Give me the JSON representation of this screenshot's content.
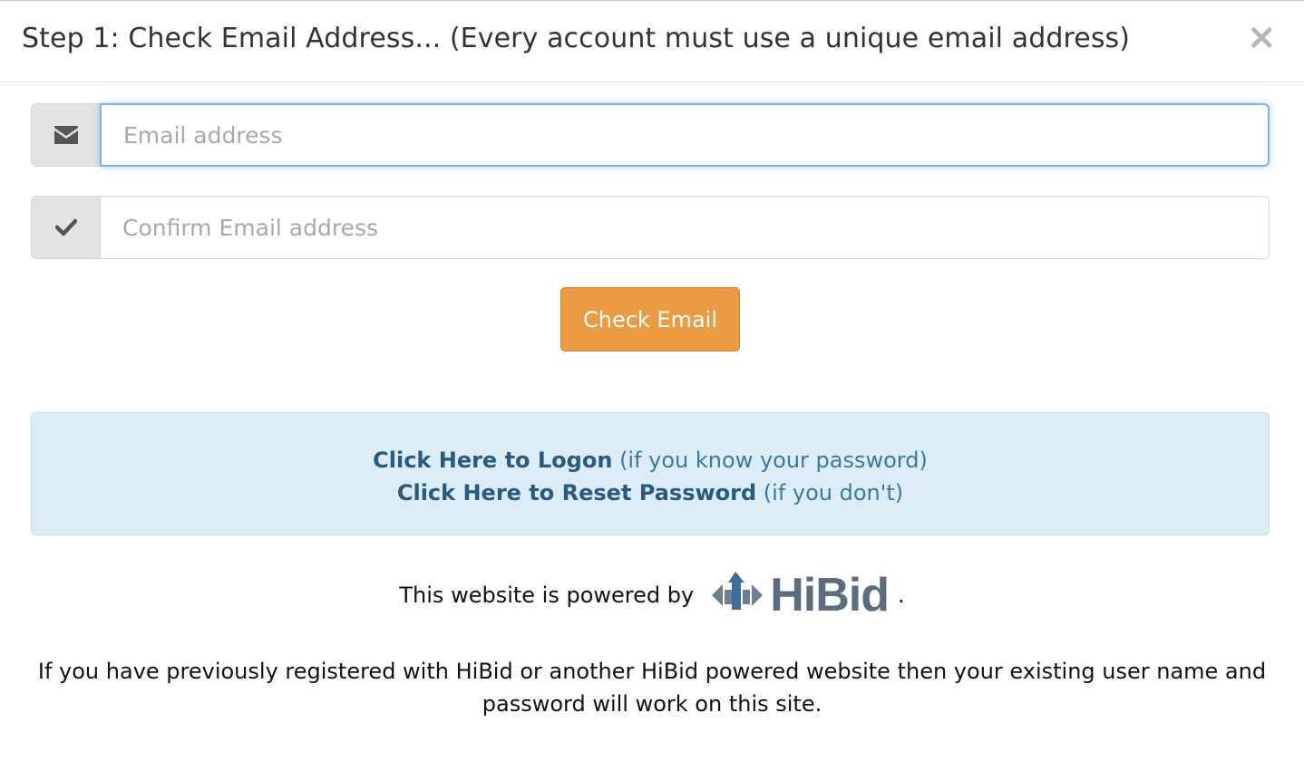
{
  "modal": {
    "title": "Step 1: Check Email Address... (Every account must use a unique email address)",
    "close_glyph": "×"
  },
  "form": {
    "email": {
      "placeholder": "Email address",
      "value": "",
      "icon": "envelope-icon"
    },
    "confirm_email": {
      "placeholder": "Confirm Email address",
      "value": "",
      "icon": "checkmark-icon"
    },
    "submit_label": "Check Email"
  },
  "info": {
    "logon_link": "Click Here to Logon",
    "logon_note": "(if you know your password)",
    "reset_link": "Click Here to Reset Password",
    "reset_note": "(if you don't)"
  },
  "powered": {
    "prefix": "This website is powered by",
    "logo_text": "HiBid",
    "suffix": "."
  },
  "footer": {
    "text": "If you have previously registered with HiBid or another HiBid powered website then your existing user name and password will work on this site."
  },
  "colors": {
    "accent_button": "#eb9c43",
    "info_background": "#dcedf7",
    "link_color": "#2a5a80",
    "logo_gray": "#5b6d80",
    "logo_blue": "#3d6d9e"
  }
}
